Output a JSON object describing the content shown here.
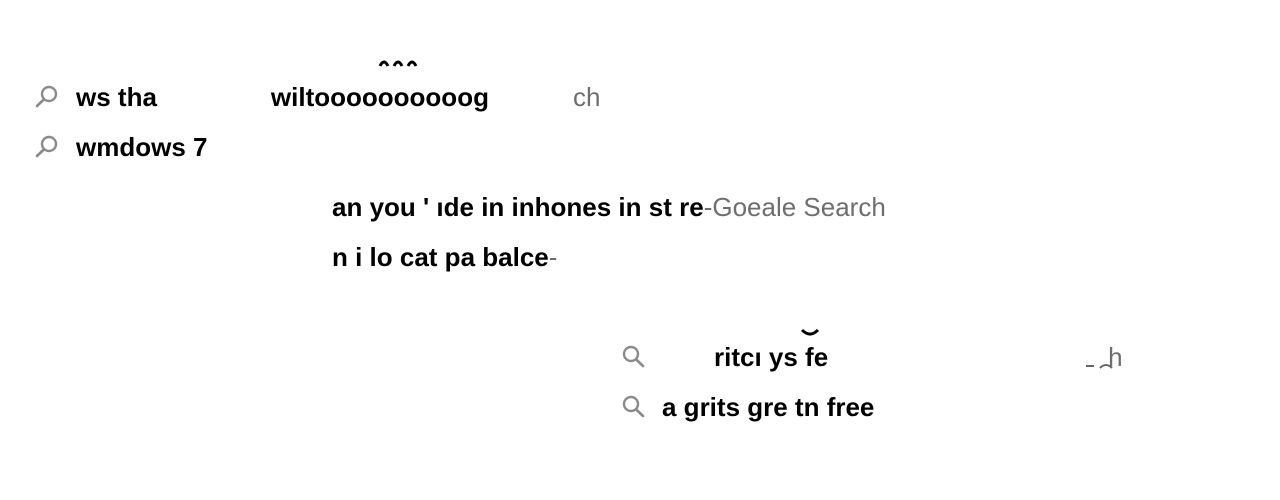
{
  "colors": {
    "background": "#ffffff",
    "query_text": "#000000",
    "suffix_text": "#6e6e6e",
    "icon": "#8a8a8a"
  },
  "suggestions": [
    {
      "icon": "search-icon",
      "query": "ws tha",
      "query_tail": "wiltoooooooooog",
      "separator": "",
      "suffix": "ch"
    },
    {
      "icon": "search-icon",
      "query": "wmdows 7",
      "query_tail": "",
      "separator": "",
      "suffix": ""
    },
    {
      "icon": "search-icon",
      "query": "an you ' ıde in inhones in st re",
      "query_tail": "",
      "separator": " - ",
      "suffix": "Goeale Search"
    },
    {
      "icon": "search-icon",
      "query": "n i lo        cat      pa balce",
      "query_tail": "",
      "separator": " -",
      "suffix": ""
    },
    {
      "icon": "search-icon",
      "query": "ritcı              ys fe",
      "query_tail": "",
      "separator": "",
      "suffix": "h"
    },
    {
      "icon": "search-icon",
      "query": "a    grits gre  tn free",
      "query_tail": "",
      "separator": "",
      "suffix": ""
    }
  ]
}
